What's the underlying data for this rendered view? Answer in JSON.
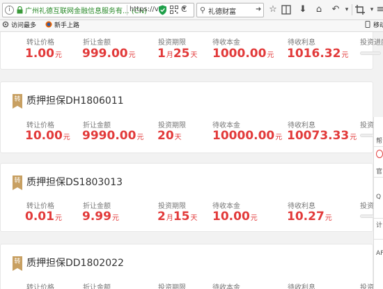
{
  "browser": {
    "site_owner": "广州礼德互联网金融信息服务有... (CN)",
    "url": "https://v",
    "search_text": "礼德财富",
    "info_glyph": "i",
    "reload_glyph": "C",
    "dropdown_glyph": "▾",
    "search_glyph": "⚲",
    "toolbar_icons": [
      "star-icon",
      "reading-list-icon",
      "download-icon",
      "home-icon",
      "back-icon",
      "dropdown-icon",
      "crop-icon",
      "dropdown-icon",
      "menu-icon"
    ]
  },
  "bookmarks": {
    "items": [
      {
        "label": "访问最多"
      },
      {
        "label": "新手上路"
      }
    ],
    "mobile_label": "移动"
  },
  "labels": {
    "transfer_price": "转让价格",
    "discount_amount": "折让金额",
    "term": "投资期限",
    "principal": "待收本金",
    "interest": "待收利息",
    "progress": "投资进度",
    "currency_unit": "元",
    "month_unit": "月",
    "day_unit": "天",
    "badge": "转"
  },
  "products": [
    {
      "title": "",
      "price": "1.00",
      "discount": "999.00",
      "term_months": "1",
      "term_days": "25",
      "principal": "1000.00",
      "interest": "1016.32"
    },
    {
      "title": "质押担保DH1806011",
      "price": "10.00",
      "discount": "9990.00",
      "term_months": "",
      "term_days": "20",
      "principal": "10000.00",
      "interest": "10073.33"
    },
    {
      "title": "质押担保DS1803013",
      "price": "0.01",
      "discount": "9.99",
      "term_months": "2",
      "term_days": "15",
      "principal": "10.00",
      "interest": "10.27"
    },
    {
      "title": "质押担保DD1802022",
      "price": "",
      "discount": "",
      "term_months": "",
      "term_days": "",
      "principal": "",
      "interest": ""
    }
  ],
  "side_widget": {
    "items": [
      "帮",
      "官",
      "Q",
      "计",
      "AF"
    ]
  },
  "colors": {
    "accent_red": "#e23a3a",
    "badge_gold": "#c8a062",
    "url_green": "#2a8a2a"
  }
}
